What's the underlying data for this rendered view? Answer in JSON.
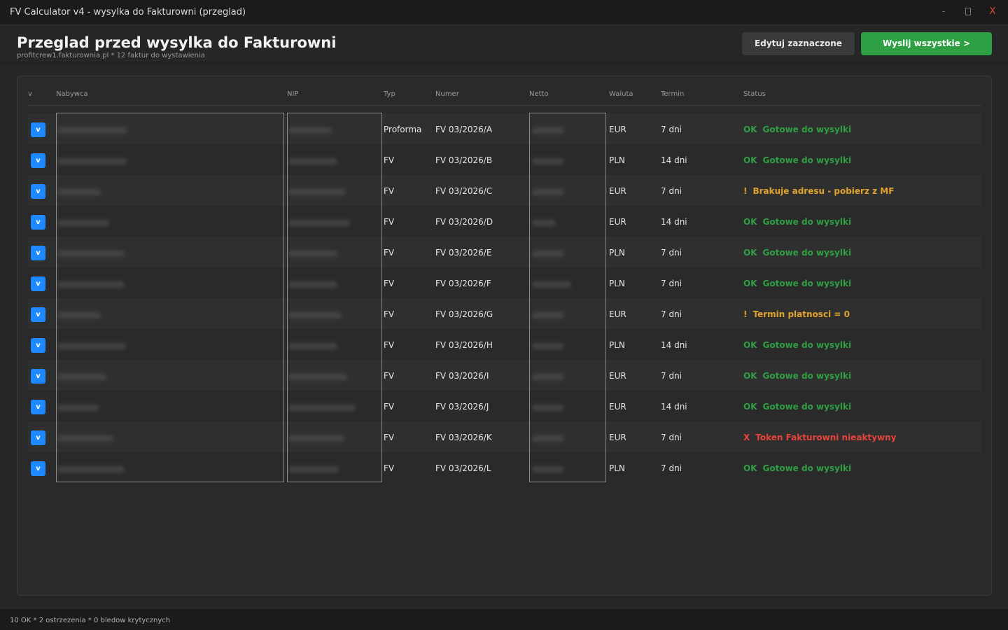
{
  "window": {
    "title": "FV Calculator v4 - wysylka do Fakturowni (przeglad)",
    "minimize": "-",
    "close": "X"
  },
  "header": {
    "title": "Przeglad przed wysylka do Fakturowni",
    "subtitle": "profitcrew1.fakturownia.pl  *  12 faktur do wystawienia",
    "edit_button": "Edytuj zaznaczone",
    "send_button": "Wyslij wszystkie >"
  },
  "table": {
    "columns": [
      "v",
      "Nabywca",
      "NIP",
      "Typ",
      "Numer",
      "Netto",
      "Waluta",
      "Termin",
      "Status"
    ],
    "rows": [
      {
        "check": "v",
        "typ": "Proforma",
        "numer": "FV 03/2026/A",
        "waluta": "EUR",
        "termin": "7 dni",
        "code": "OK",
        "status": "Gotowe do wysylki",
        "level": "ok"
      },
      {
        "check": "v",
        "typ": "FV",
        "numer": "FV 03/2026/B",
        "waluta": "PLN",
        "termin": "14 dni",
        "code": "OK",
        "status": "Gotowe do wysylki",
        "level": "ok"
      },
      {
        "check": "v",
        "typ": "FV",
        "numer": "FV 03/2026/C",
        "waluta": "EUR",
        "termin": "7 dni",
        "code": "!",
        "status": "Brakuje adresu - pobierz z MF",
        "level": "warn"
      },
      {
        "check": "v",
        "typ": "FV",
        "numer": "FV 03/2026/D",
        "waluta": "EUR",
        "termin": "14 dni",
        "code": "OK",
        "status": "Gotowe do wysylki",
        "level": "ok"
      },
      {
        "check": "v",
        "typ": "FV",
        "numer": "FV 03/2026/E",
        "waluta": "PLN",
        "termin": "7 dni",
        "code": "OK",
        "status": "Gotowe do wysylki",
        "level": "ok"
      },
      {
        "check": "v",
        "typ": "FV",
        "numer": "FV 03/2026/F",
        "waluta": "PLN",
        "termin": "7 dni",
        "code": "OK",
        "status": "Gotowe do wysylki",
        "level": "ok"
      },
      {
        "check": "v",
        "typ": "FV",
        "numer": "FV 03/2026/G",
        "waluta": "EUR",
        "termin": "7 dni",
        "code": "!",
        "status": "Termin platnosci = 0",
        "level": "warn"
      },
      {
        "check": "v",
        "typ": "FV",
        "numer": "FV 03/2026/H",
        "waluta": "PLN",
        "termin": "14 dni",
        "code": "OK",
        "status": "Gotowe do wysylki",
        "level": "ok"
      },
      {
        "check": "v",
        "typ": "FV",
        "numer": "FV 03/2026/I",
        "waluta": "EUR",
        "termin": "7 dni",
        "code": "OK",
        "status": "Gotowe do wysylki",
        "level": "ok"
      },
      {
        "check": "v",
        "typ": "FV",
        "numer": "FV 03/2026/J",
        "waluta": "EUR",
        "termin": "14 dni",
        "code": "OK",
        "status": "Gotowe do wysylki",
        "level": "ok"
      },
      {
        "check": "v",
        "typ": "FV",
        "numer": "FV 03/2026/K",
        "waluta": "EUR",
        "termin": "7 dni",
        "code": "X",
        "status": "Token Fakturowni nieaktywny",
        "level": "err"
      },
      {
        "check": "v",
        "typ": "FV",
        "numer": "FV 03/2026/L",
        "waluta": "PLN",
        "termin": "7 dni",
        "code": "OK",
        "status": "Gotowe do wysylki",
        "level": "ok"
      }
    ]
  },
  "colors": {
    "ok": "#2ea043",
    "warn": "#e0a32e",
    "error": "#e5453b",
    "checkbox": "#1e88ff"
  },
  "statusbar": {
    "text": "10 OK * 2 ostrzezenia * 0 bledow krytycznych"
  }
}
